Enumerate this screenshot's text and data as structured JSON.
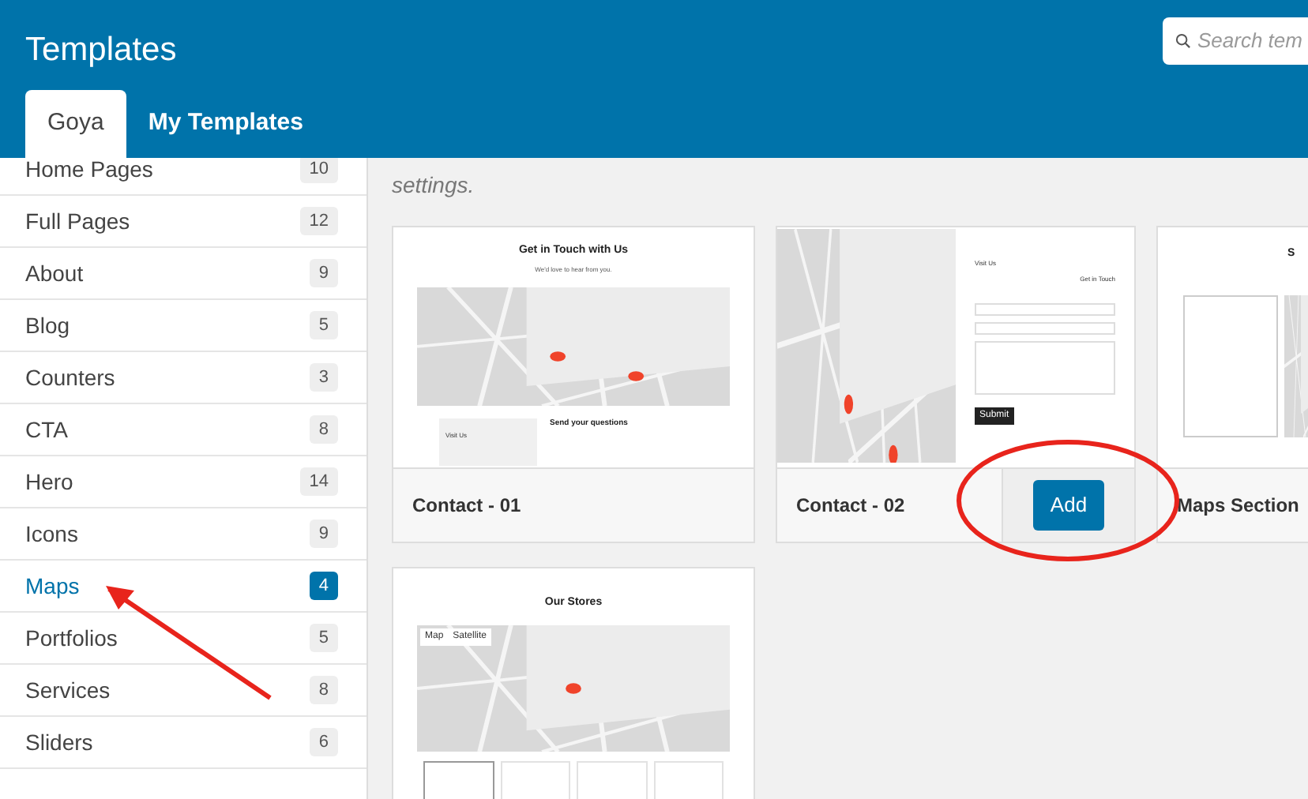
{
  "header": {
    "title": "Templates",
    "search": {
      "placeholder": "Search tem"
    },
    "tabs": [
      {
        "label": "Goya",
        "selected": true
      },
      {
        "label": "My Templates",
        "selected": false
      }
    ]
  },
  "sidebar": {
    "items": [
      {
        "label": "Home Pages",
        "count": "10",
        "selected": false
      },
      {
        "label": "Full Pages",
        "count": "12",
        "selected": false
      },
      {
        "label": "About",
        "count": "9",
        "selected": false
      },
      {
        "label": "Blog",
        "count": "5",
        "selected": false
      },
      {
        "label": "Counters",
        "count": "3",
        "selected": false
      },
      {
        "label": "CTA",
        "count": "8",
        "selected": false
      },
      {
        "label": "Hero",
        "count": "14",
        "selected": false
      },
      {
        "label": "Icons",
        "count": "9",
        "selected": false
      },
      {
        "label": "Maps",
        "count": "4",
        "selected": true
      },
      {
        "label": "Portfolios",
        "count": "5",
        "selected": false
      },
      {
        "label": "Services",
        "count": "8",
        "selected": false
      },
      {
        "label": "Sliders",
        "count": "6",
        "selected": false
      }
    ]
  },
  "content": {
    "intro": "settings.",
    "templates": [
      {
        "kind": "contact-map-top",
        "title": "Contact - 01",
        "preview": {
          "heading": "Get in Touch with Us",
          "subheading": "We'd love to hear from you.",
          "aside_title": "Visit Us",
          "form_title": "Send your questions"
        }
      },
      {
        "kind": "contact-map-side",
        "title": "Contact - 02",
        "add_button": "Add",
        "preview": {
          "heading": "Visit Us",
          "form_title": "Get in Touch",
          "submit": "Submit"
        }
      },
      {
        "kind": "stores-list",
        "title": "Maps Section",
        "preview": {
          "heading": "S"
        }
      },
      {
        "kind": "stores-map",
        "preview": {
          "heading": "Our Stores",
          "map_tabs": [
            "Map",
            "Satellite"
          ]
        }
      }
    ]
  }
}
